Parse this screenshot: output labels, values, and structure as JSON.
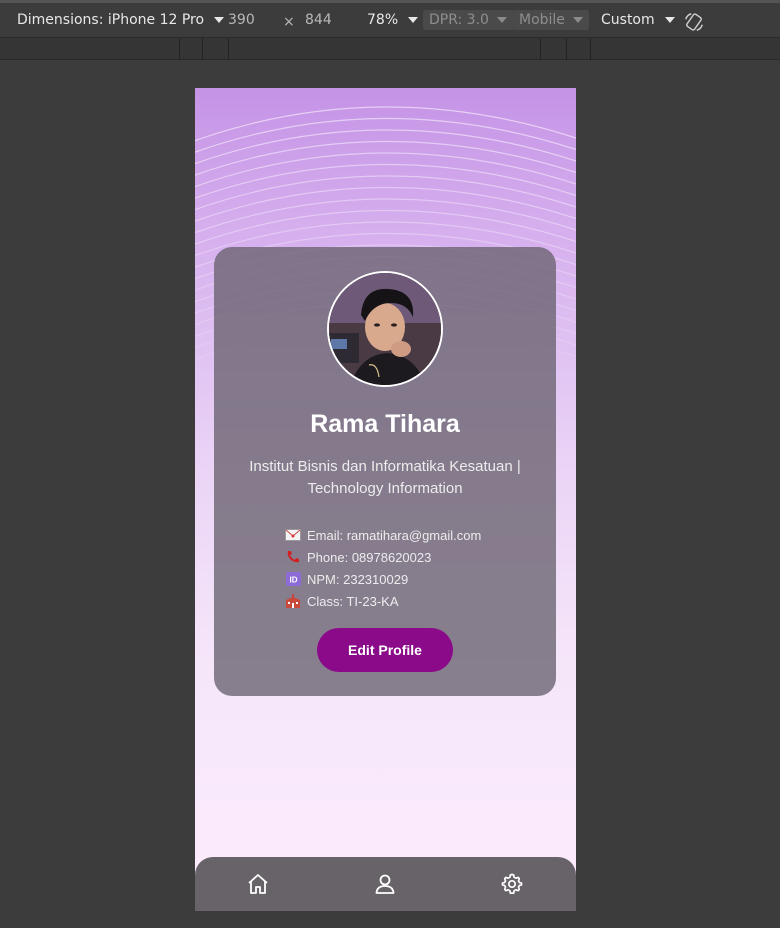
{
  "devtools": {
    "dimensions_label": "Dimensions: iPhone 12 Pro",
    "width": "390",
    "times": "×",
    "height": "844",
    "zoom": "78%",
    "dpr": "DPR: 3.0",
    "mode": "Mobile",
    "throttle": "Custom",
    "rotate_icon": "rotate-icon"
  },
  "profile": {
    "name": "Rama Tihara",
    "subtitle_line1": "Institut Bisnis dan Informatika Kesatuan |",
    "subtitle_line2": "Technology Information",
    "details": [
      {
        "icon": "envelope-icon",
        "text": "Email: ramatihara@gmail.com"
      },
      {
        "icon": "phone-icon",
        "text": "Phone: 08978620023"
      },
      {
        "icon": "id-icon",
        "text": "NPM: 232310029"
      },
      {
        "icon": "school-icon",
        "text": "Class: TI-23-KA"
      }
    ],
    "edit_button": "Edit Profile"
  },
  "nav": {
    "items": [
      {
        "icon": "home-icon"
      },
      {
        "icon": "user-icon"
      },
      {
        "icon": "settings-icon"
      }
    ]
  },
  "colors": {
    "accent": "#8a0a8a",
    "card": "#68626e",
    "navbar": "#686368"
  }
}
